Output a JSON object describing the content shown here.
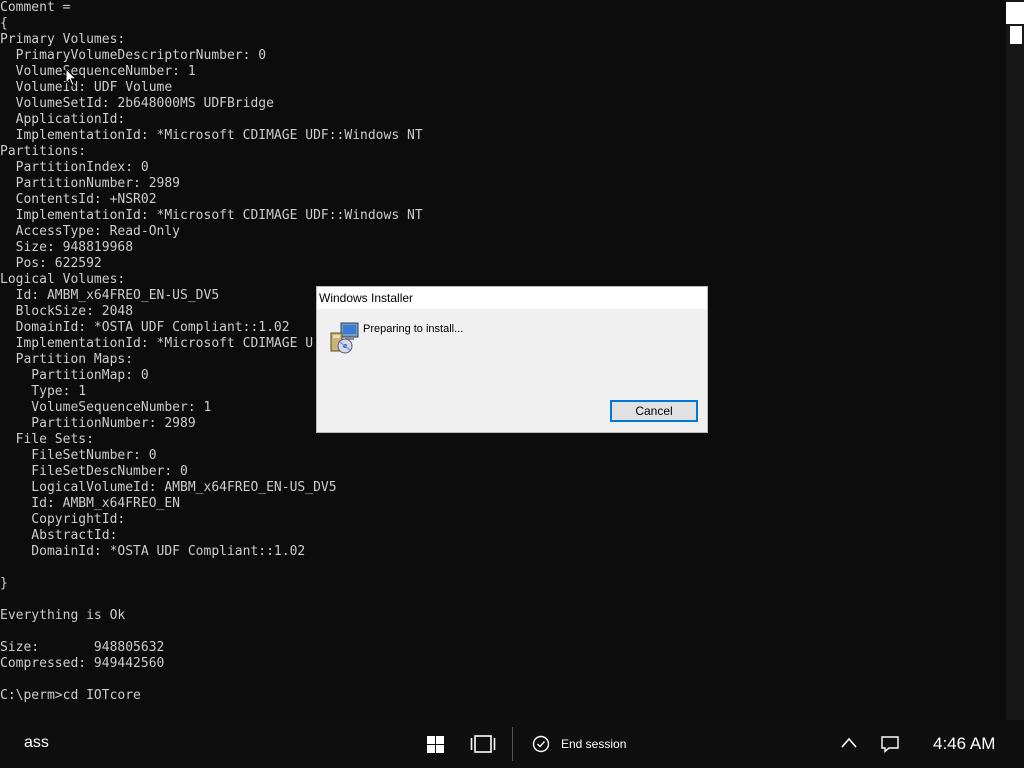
{
  "console": {
    "lines": [
      "Comment =",
      "{",
      "Primary Volumes:",
      "  PrimaryVolumeDescriptorNumber: 0",
      "  VolumeSequenceNumber: 1",
      "  VolumeId: UDF Volume",
      "  VolumeSetId: 2b648000MS UDFBridge",
      "  ApplicationId:",
      "  ImplementationId: *Microsoft CDIMAGE UDF::Windows NT",
      "Partitions:",
      "  PartitionIndex: 0",
      "  PartitionNumber: 2989",
      "  ContentsId: +NSR02",
      "  ImplementationId: *Microsoft CDIMAGE UDF::Windows NT",
      "  AccessType: Read-Only",
      "  Size: 948819968",
      "  Pos: 622592",
      "Logical Volumes:",
      "  Id: AMBM_x64FREO_EN-US_DV5",
      "  BlockSize: 2048",
      "  DomainId: *OSTA UDF Compliant::1.02",
      "  ImplementationId: *Microsoft CDIMAGE U",
      "  Partition Maps:",
      "    PartitionMap: 0",
      "    Type: 1",
      "    VolumeSequenceNumber: 1",
      "    PartitionNumber: 2989",
      "  File Sets:",
      "    FileSetNumber: 0",
      "    FileSetDescNumber: 0",
      "    LogicalVolumeId: AMBM_x64FREO_EN-US_DV5",
      "    Id: AMBM_x64FREO_EN",
      "    CopyrightId:",
      "    AbstractId:",
      "    DomainId: *OSTA UDF Compliant::1.02",
      "",
      "}",
      "",
      "Everything is Ok",
      "",
      "Size:       948805632",
      "Compressed: 949442560",
      "",
      "C:\\perm>cd IOTcore"
    ],
    "text_color": "#cccccc",
    "background": "#0c0c0c"
  },
  "dialog": {
    "title": "Windows Installer",
    "message": "Preparing to install...",
    "cancel_label": "Cancel",
    "icon": "installer-icon"
  },
  "taskbar": {
    "search_text": "ass",
    "end_session_label": "End session",
    "clock": "4:46 AM",
    "icons": [
      "windows-start-icon",
      "task-view-icon",
      "power-icon",
      "chevron-up-icon",
      "notification-icon"
    ]
  },
  "colors": {
    "accent": "#0078d7",
    "taskbar": "#0f0f0f",
    "dialog_bg": "#f0f0f0"
  }
}
